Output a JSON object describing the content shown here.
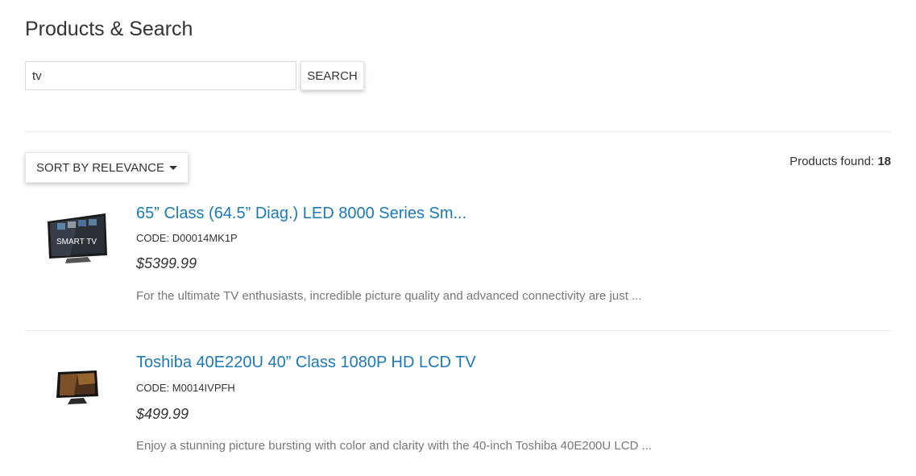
{
  "page": {
    "title": "Products & Search"
  },
  "search": {
    "value": "tv",
    "button_label": "SEARCH"
  },
  "sort": {
    "label": "SORT BY RELEVANCE"
  },
  "results": {
    "found_label": "Products found:",
    "found_count": "18"
  },
  "products": [
    {
      "name": "65” Class (64.5” Diag.) LED 8000 Series Sm...",
      "code": "CODE: D00014MK1P",
      "price": "$5399.99",
      "description": "For the ultimate TV enthusiasts, incredible picture quality and advanced connectivity are just ...",
      "image_text": "SMART TV"
    },
    {
      "name": "Toshiba 40E220U 40” Class 1080P HD LCD TV",
      "code": "CODE: M0014IVPFH",
      "price": "$499.99",
      "description": "Enjoy a stunning picture bursting with color and clarity with the 40-inch Toshiba 40E200U LCD ..."
    }
  ],
  "colors": {
    "link": "#1a7ab8",
    "text": "#333333",
    "muted": "#777777"
  }
}
